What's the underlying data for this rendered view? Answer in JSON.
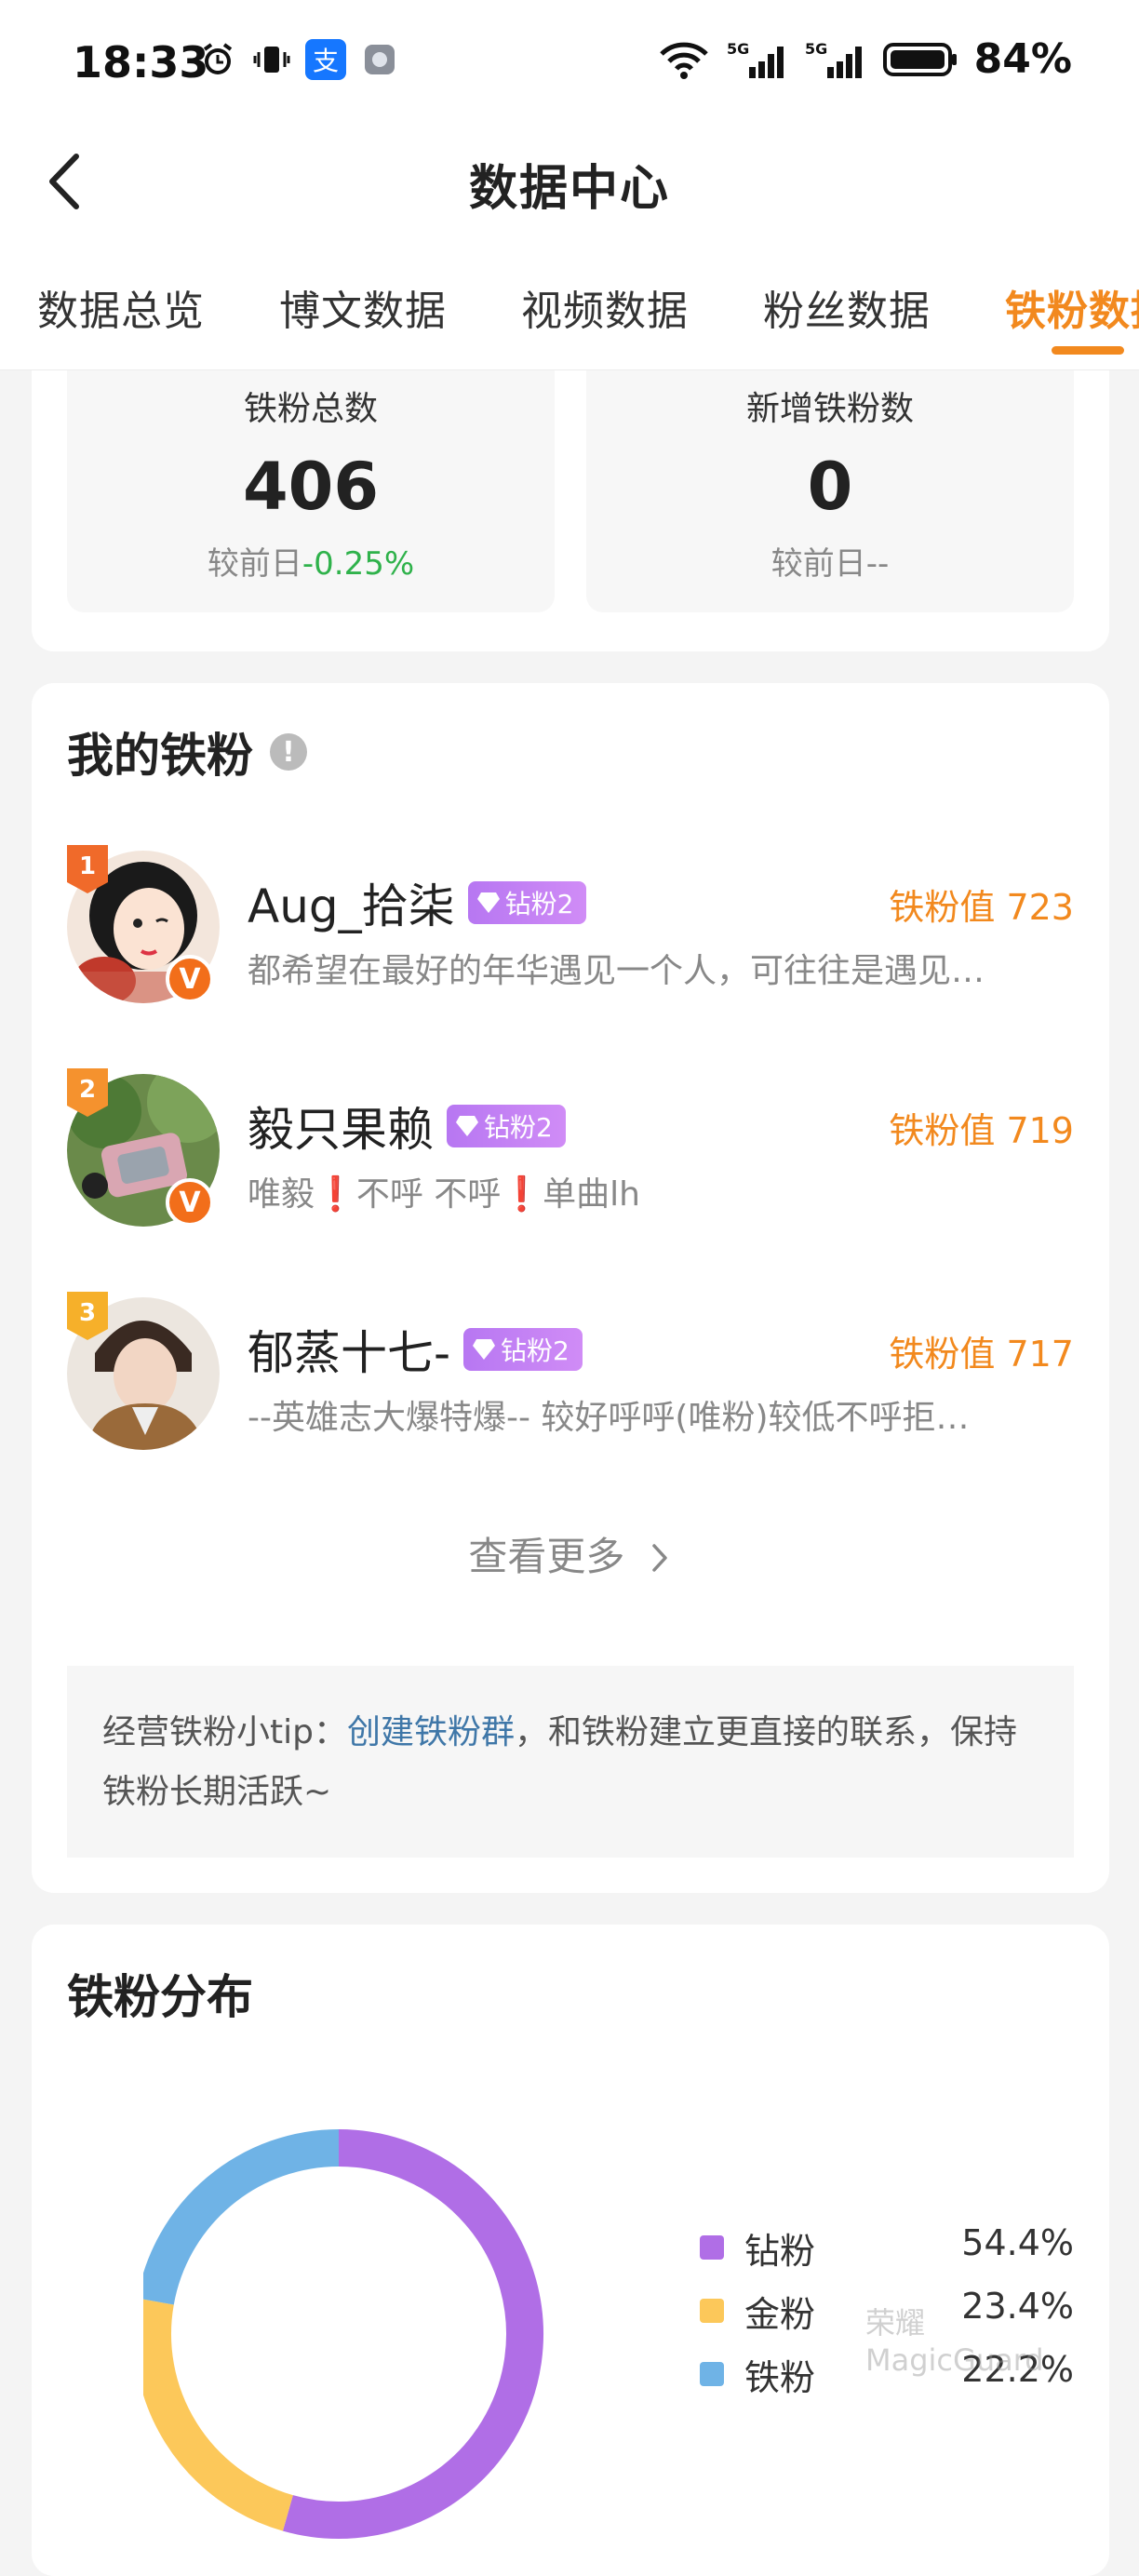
{
  "status_bar": {
    "time": "18:33",
    "battery": "84%"
  },
  "header": {
    "title": "数据中心"
  },
  "tabs": [
    {
      "label": "数据总览"
    },
    {
      "label": "博文数据"
    },
    {
      "label": "视频数据"
    },
    {
      "label": "粉丝数据"
    },
    {
      "label": "铁粉数据"
    }
  ],
  "summary": {
    "total": {
      "label": "铁粉总数",
      "value": "406",
      "compare_prefix": "较前日",
      "compare_value": "-0.25%"
    },
    "new": {
      "label": "新增铁粉数",
      "value": "0",
      "compare_prefix": "较前日",
      "compare_value": "--"
    }
  },
  "my_fans": {
    "title": "我的铁粉",
    "items": [
      {
        "rank": "1",
        "name": "Aug_拾柒",
        "level": "钻粉2",
        "value": "铁粉值 723",
        "desc": "都希望在最好的年华遇见一个人，可往往是遇见…"
      },
      {
        "rank": "2",
        "name": "毅只果赖",
        "level": "钻粉2",
        "value": "铁粉值 719",
        "desc": "唯毅❗不呼 不呼❗单曲lh"
      },
      {
        "rank": "3",
        "name": "郁蒸十七-",
        "level": "钻粉2",
        "value": "铁粉值 717",
        "desc": "--英雄志大爆特爆-- 较好呼呼(唯粉)较低不呼拒…"
      }
    ],
    "see_more": "查看更多",
    "tip_prefix": "经营铁粉小tip：",
    "tip_link": "创建铁粉群",
    "tip_suffix": "，和铁粉建立更直接的联系，保持铁粉长期活跃~"
  },
  "distribution": {
    "title": "铁粉分布",
    "watermark_line1": "荣耀",
    "watermark_line2": "MagicGuard"
  },
  "chart_data": {
    "type": "pie",
    "categories": [
      "钻粉",
      "金粉",
      "铁粉"
    ],
    "values": [
      54.4,
      23.4,
      22.2
    ],
    "labels": [
      "54.4%",
      "23.4%",
      "22.2%"
    ],
    "colors": [
      "#b06ee6",
      "#fcc85a",
      "#6fb3e6"
    ],
    "donut": true,
    "legend_position": "right"
  }
}
